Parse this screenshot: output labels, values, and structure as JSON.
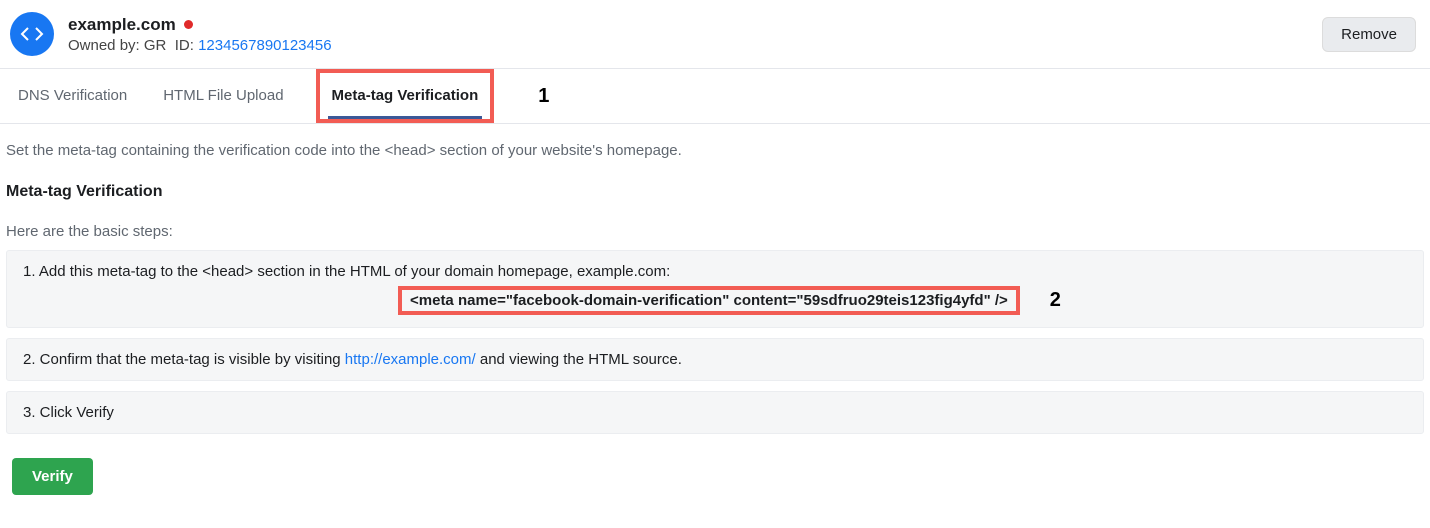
{
  "header": {
    "domain": "example.com",
    "owned_by_label": "Owned by:",
    "owned_by_value": "GR",
    "id_label": "ID:",
    "id_value": "1234567890123456",
    "remove_label": "Remove"
  },
  "tabs": {
    "dns": "DNS Verification",
    "html": "HTML File Upload",
    "meta": "Meta-tag Verification",
    "callout1": "1"
  },
  "instructions_top": "Set the meta-tag containing the verification code into the <head> section of your website's homepage.",
  "section_title": "Meta-tag Verification",
  "steps_intro": "Here are the basic steps:",
  "step1_text": "1. Add this meta-tag to the <head> section in the HTML of your domain homepage, example.com:",
  "step1_code": "<meta name=\"facebook-domain-verification\" content=\"59sdfruo29teis123fig4yfd\" />",
  "callout2": "2",
  "step2_prefix": "2. Confirm that the meta-tag is visible by visiting ",
  "step2_link": "http://example.com/",
  "step2_suffix": " and viewing the HTML source.",
  "step3_text": "3. Click Verify",
  "verify_button": "Verify"
}
